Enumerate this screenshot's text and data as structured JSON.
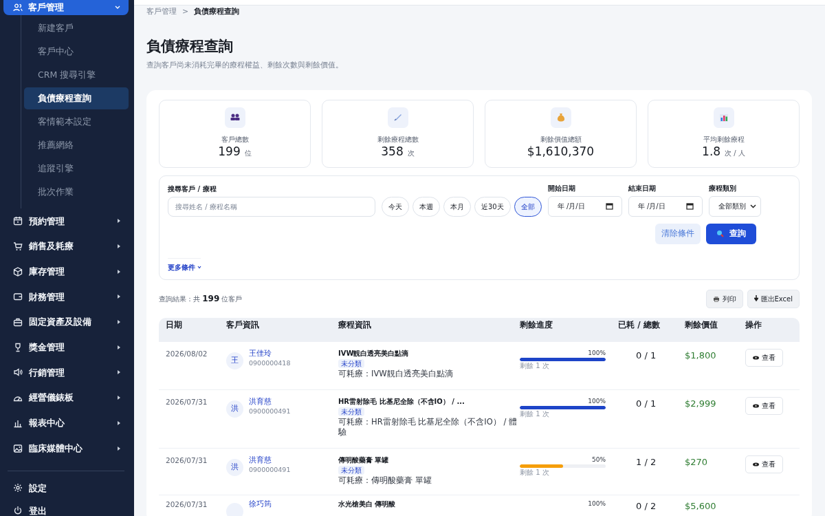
{
  "sidebar": {
    "group": {
      "label": "客戶管理",
      "expanded": true
    },
    "sub_items": [
      {
        "label": "新建客戶",
        "selected": false
      },
      {
        "label": "客戶中心",
        "selected": false
      },
      {
        "label": "CRM 搜尋引擎",
        "selected": false
      },
      {
        "label": "負債療程查詢",
        "selected": true
      },
      {
        "label": "客情範本設定",
        "selected": false
      },
      {
        "label": "推薦網絡",
        "selected": false
      },
      {
        "label": "追蹤引擎",
        "selected": false
      },
      {
        "label": "批次作業",
        "selected": false
      }
    ],
    "items": [
      {
        "label": "預約管理"
      },
      {
        "label": "銷售及耗療"
      },
      {
        "label": "庫存管理"
      },
      {
        "label": "財務管理"
      },
      {
        "label": "固定資產及設備"
      },
      {
        "label": "獎金管理"
      },
      {
        "label": "行銷管理"
      },
      {
        "label": "經營儀錶板"
      },
      {
        "label": "報表中心"
      },
      {
        "label": "臨床媒體中心"
      }
    ],
    "footer_items": [
      {
        "label": "設定"
      },
      {
        "label": "登出"
      }
    ]
  },
  "breadcrumb": {
    "items": [
      "客戶管理",
      "負債療程查詢"
    ],
    "separator": ">"
  },
  "page": {
    "title": "負債療程查詢",
    "subtitle": "查詢客戶尚未消耗完畢的療程權益、剩餘次數與剩餘價值。"
  },
  "stats": [
    {
      "label": "客戶總數",
      "value": "199",
      "unit": "位"
    },
    {
      "label": "剩餘療程總數",
      "value": "358",
      "unit": "次"
    },
    {
      "label": "剩餘價值總額",
      "value": "$1,610,370"
    },
    {
      "label": "平均剩餘療程",
      "value": "1.8",
      "unit": "次 / 人"
    }
  ],
  "filters": {
    "search": {
      "label": "搜尋客戶 / 療程",
      "placeholder": "搜尋姓名 / 療程名稱"
    },
    "quick_ranges": [
      {
        "label": "今天",
        "selected": false
      },
      {
        "label": "本週",
        "selected": false
      },
      {
        "label": "本月",
        "selected": false
      },
      {
        "label": "近30天",
        "selected": false
      },
      {
        "label": "全部",
        "selected": true
      }
    ],
    "start_date": {
      "label": "開始日期",
      "placeholder": "年 /月/日"
    },
    "end_date": {
      "label": "結束日期",
      "placeholder": "年 /月/日"
    },
    "category": {
      "label": "療程類別",
      "value": "全部類別"
    },
    "clear_button": "清除條件",
    "search_button": "查詢",
    "more_link": "更多條件"
  },
  "results": {
    "summary": "查詢結果：共 **199** 位客戶",
    "print_button": "列印",
    "export_button": "匯出Excel"
  },
  "table": {
    "columns": [
      "日期",
      "客戶資訊",
      "療程資訊",
      "剩餘進度",
      "已耗 / 總數",
      "剩餘價值",
      "操作"
    ],
    "rows": [
      {
        "date": "2026/08/02",
        "initial": "王",
        "name": "王佳玲",
        "phone": "0900000418",
        "course": "IVW靚白透亮美白點滴",
        "tag": "未分類",
        "consumable": "可耗療：IVW靚白透亮美白點滴",
        "percent": "100%",
        "level": 1,
        "color": "#1d44c8",
        "remaining": "剩餘 1 次",
        "count": "0 / 1",
        "value": "$1,800",
        "action": "查看"
      },
      {
        "date": "2026/07/31",
        "initial": "洪",
        "name": "洪育慈",
        "phone": "0900000491",
        "course": "HR雷射除毛 比基尼全除（不含IO） / ...",
        "tag": "未分類",
        "consumable": "可耗療：HR雷射除毛 比基尼全除（不含IO） / 體驗",
        "percent": "100%",
        "level": 1,
        "color": "#1d44c8",
        "remaining": "剩餘 1 次",
        "count": "0 / 1",
        "value": "$2,999",
        "action": "查看"
      },
      {
        "date": "2026/07/31",
        "initial": "洪",
        "name": "洪育慈",
        "phone": "0900000491",
        "course": "傳明酸藥膏 單罐",
        "tag": "未分類",
        "consumable": "可耗療：傳明酸藥膏 單罐",
        "percent": "50%",
        "level": 0.5,
        "color": "#f59e0b",
        "remaining": "剩餘 1 次",
        "count": "1 / 2",
        "value": "$270",
        "action": "查看"
      },
      {
        "date": "2026/07/31",
        "name": "徐巧筠",
        "course": "水光槍美白 傳明酸",
        "percent": "100%",
        "count": "0 / 2",
        "value": "$5,600"
      }
    ]
  }
}
